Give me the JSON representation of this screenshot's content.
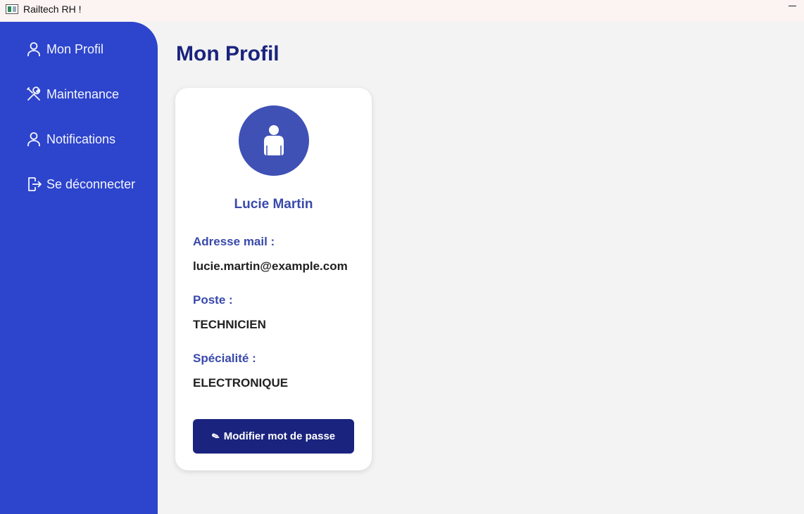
{
  "window": {
    "title": "Railtech RH !"
  },
  "sidebar": {
    "items": [
      {
        "label": "Mon Profil",
        "icon": "user-icon"
      },
      {
        "label": "Maintenance",
        "icon": "tools-icon"
      },
      {
        "label": "Notifications",
        "icon": "user-icon"
      },
      {
        "label": "Se déconnecter",
        "icon": "logout-icon"
      }
    ]
  },
  "main": {
    "title": "Mon Profil"
  },
  "profile": {
    "avatar_icon": "person-icon",
    "name": "Lucie Martin",
    "email_label": "Adresse mail :",
    "email": "lucie.martin@example.com",
    "poste_label": "Poste :",
    "poste": "TECHNICIEN",
    "specialite_label": "Spécialité :",
    "specialite": "ELECTRONIQUE",
    "button_icon": "✎",
    "button_label": "Modifier mot de passe"
  },
  "colors": {
    "sidebar": "#2d44cc",
    "title": "#1a237e",
    "accent": "#3949ab",
    "avatar": "#3f51b5",
    "button": "#1a237e"
  }
}
